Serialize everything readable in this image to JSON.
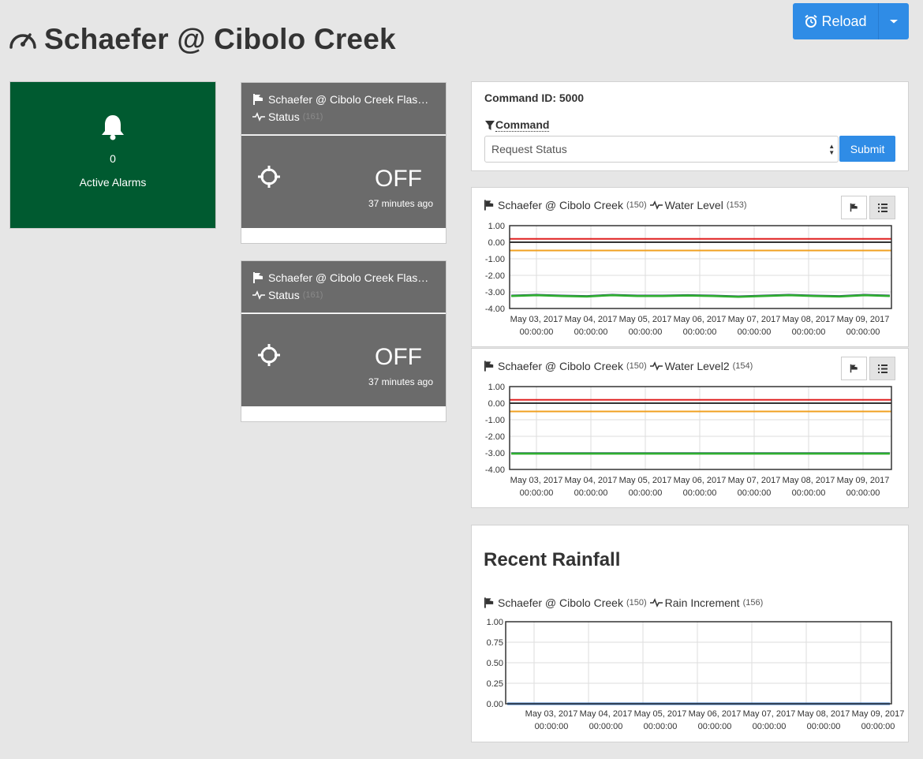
{
  "header": {
    "title": "Schaefer @ Cibolo Creek"
  },
  "reload": {
    "label": "Reload"
  },
  "alarms": {
    "count": "0",
    "label": "Active Alarms"
  },
  "flashers": [
    {
      "name": "Schaefer @ Cibolo Creek Flashe…",
      "status_label": "Status",
      "status_id": "(161)",
      "value": "OFF",
      "updated": "37 minutes ago"
    },
    {
      "name": "Schaefer @ Cibolo Creek Flashe…",
      "status_label": "Status",
      "status_id": "(161)",
      "value": "OFF",
      "updated": "37 minutes ago"
    }
  ],
  "command": {
    "id_label": "Command ID: 5000",
    "label": "Command",
    "selected": "Request Status",
    "submit_label": "Submit"
  },
  "charts": [
    {
      "station": "Schaefer @ Cibolo Creek",
      "station_id": "(150)",
      "sensor": "Water Level",
      "sensor_id": "(153)"
    },
    {
      "station": "Schaefer @ Cibolo Creek",
      "station_id": "(150)",
      "sensor": "Water Level2",
      "sensor_id": "(154)"
    }
  ],
  "rainfall": {
    "heading": "Recent Rainfall",
    "station": "Schaefer @ Cibolo Creek",
    "station_id": "(150)",
    "sensor": "Rain Increment",
    "sensor_id": "(156)"
  },
  "colors": {
    "alarm_bg": "#005a30",
    "accent": "#2f8ce6",
    "flasher_bg": "#6b6b6b",
    "red_line": "#e02020",
    "orange_line": "#f0a020",
    "green_line": "#2fb02f"
  },
  "chart_data": [
    {
      "type": "line",
      "ylim": [
        -4,
        1
      ],
      "yticks": [
        "1.00",
        "0.00",
        "-1.00",
        "-2.00",
        "-3.00",
        "-4.00"
      ],
      "x_ticks": [
        "May 03, 2017",
        "May 04, 2017",
        "May 05, 2017",
        "May 06, 2017",
        "May 07, 2017",
        "May 08, 2017",
        "May 09, 2017"
      ],
      "x_tick_times": [
        "00:00:00",
        "00:00:00",
        "00:00:00",
        "00:00:00",
        "00:00:00",
        "00:00:00",
        "00:00:00"
      ],
      "thresholds": [
        {
          "color": "#e02020",
          "value": 0.2
        },
        {
          "color": "#333333",
          "value": 0.0
        },
        {
          "color": "#f0a020",
          "value": -0.5
        }
      ],
      "series": [
        {
          "color": "#2fb02f",
          "values": [
            -3.25,
            -3.2,
            -3.25,
            -3.28,
            -3.2,
            -3.25,
            -3.25,
            -3.22,
            -3.25,
            -3.3,
            -3.25,
            -3.2,
            -3.25,
            -3.28,
            -3.2,
            -3.25
          ]
        }
      ]
    },
    {
      "type": "line",
      "ylim": [
        -4,
        1
      ],
      "yticks": [
        "1.00",
        "0.00",
        "-1.00",
        "-2.00",
        "-3.00",
        "-4.00"
      ],
      "x_ticks": [
        "May 03, 2017",
        "May 04, 2017",
        "May 05, 2017",
        "May 06, 2017",
        "May 07, 2017",
        "May 08, 2017",
        "May 09, 2017"
      ],
      "x_tick_times": [
        "00:00:00",
        "00:00:00",
        "00:00:00",
        "00:00:00",
        "00:00:00",
        "00:00:00",
        "00:00:00"
      ],
      "thresholds": [
        {
          "color": "#e02020",
          "value": 0.2
        },
        {
          "color": "#333333",
          "value": 0.0
        },
        {
          "color": "#f0a020",
          "value": -0.5
        }
      ],
      "series": [
        {
          "color": "#2fb02f",
          "values": [
            -3.05,
            -3.05,
            -3.05,
            -3.05,
            -3.05,
            -3.05,
            -3.05,
            -3.05,
            -3.05,
            -3.05,
            -3.05,
            -3.05,
            -3.05,
            -3.05,
            -3.05,
            -3.05
          ]
        }
      ]
    },
    {
      "type": "line",
      "ylim": [
        0,
        1
      ],
      "yticks": [
        "1.00",
        "0.75",
        "0.50",
        "0.25",
        "0.00"
      ],
      "x_ticks": [
        "May 03, 2017",
        "May 04, 2017",
        "May 05, 2017",
        "May 06, 2017",
        "May 07, 2017",
        "May 08, 2017",
        "May 09, 2017"
      ],
      "x_tick_times": [
        "00:00:00",
        "00:00:00",
        "00:00:00",
        "00:00:00",
        "00:00:00",
        "00:00:00",
        "00:00:00"
      ],
      "thresholds": [],
      "series": [
        {
          "color": "#3070c0",
          "values": [
            0,
            0,
            0,
            0,
            0,
            0,
            0,
            0,
            0,
            0,
            0,
            0,
            0,
            0,
            0,
            0
          ]
        }
      ]
    }
  ]
}
